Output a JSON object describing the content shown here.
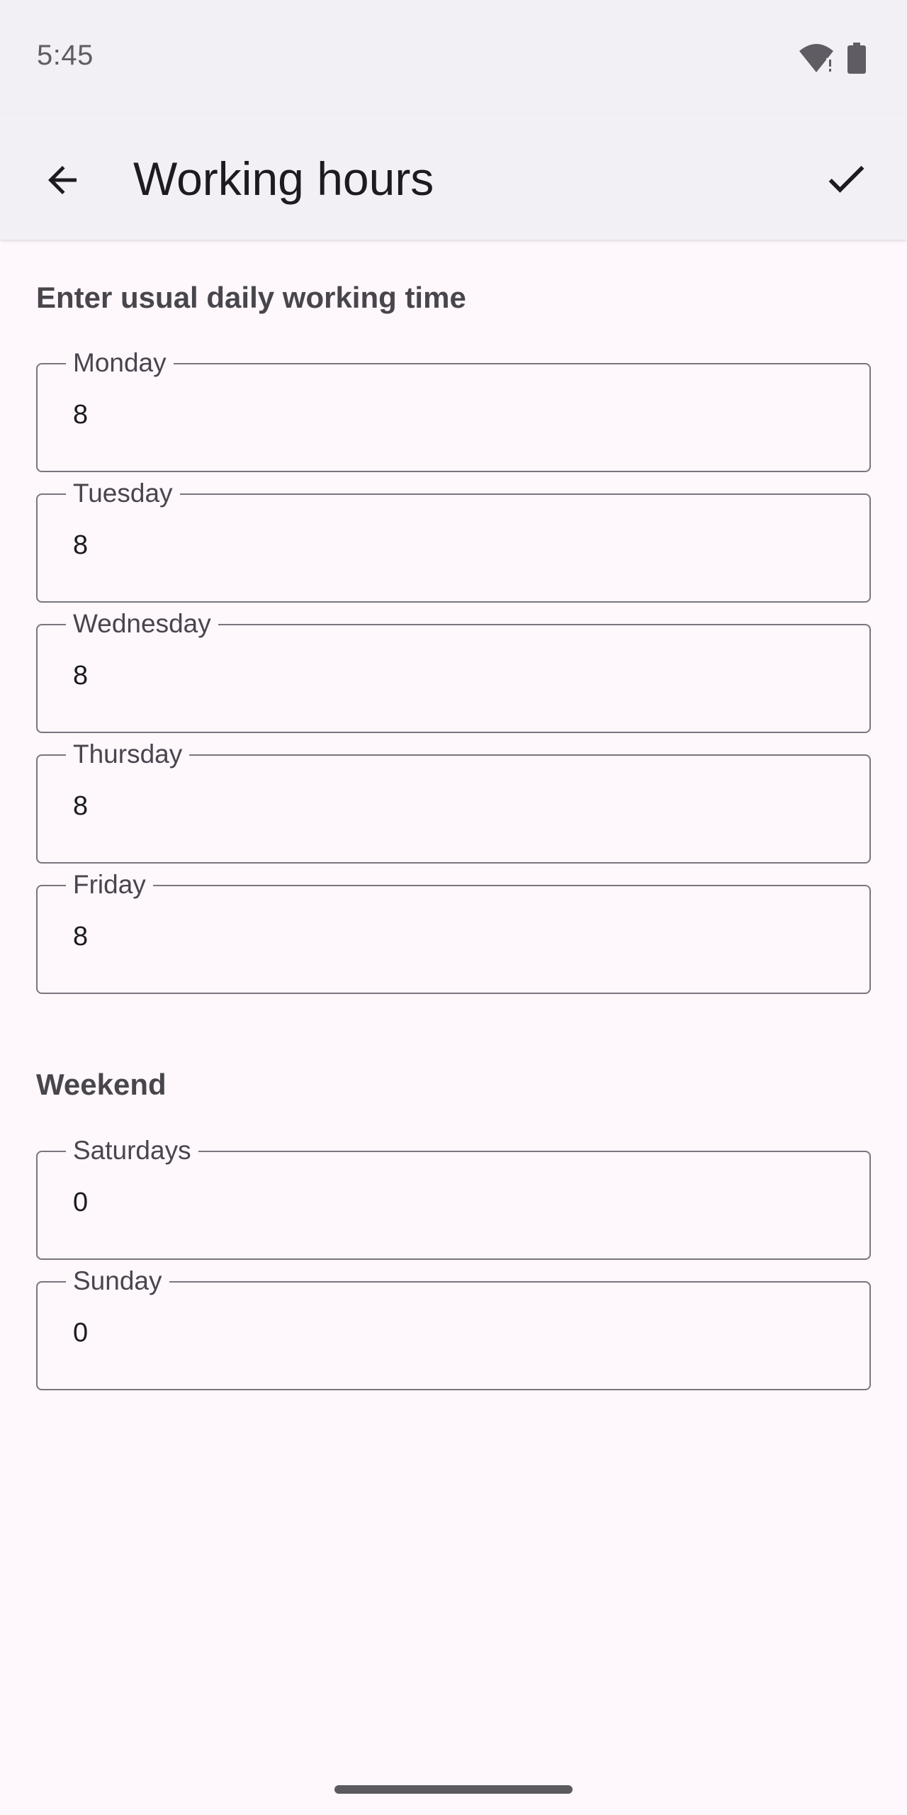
{
  "status_bar": {
    "time": "5:45",
    "icons": [
      "wifi-icon",
      "battery-icon"
    ]
  },
  "app_bar": {
    "title": "Working hours",
    "back_icon": "arrow-left-icon",
    "save_icon": "check-icon"
  },
  "weekday_section": {
    "header": "Enter usual daily working time",
    "fields": [
      {
        "label": "Monday",
        "value": "8"
      },
      {
        "label": "Tuesday",
        "value": "8"
      },
      {
        "label": "Wednesday",
        "value": "8"
      },
      {
        "label": "Thursday",
        "value": "8"
      },
      {
        "label": "Friday",
        "value": "8"
      }
    ]
  },
  "weekend_section": {
    "header": "Weekend",
    "fields": [
      {
        "label": "Saturdays",
        "value": "0"
      },
      {
        "label": "Sunday",
        "value": "0"
      }
    ]
  },
  "colors": {
    "background": "#fef7fb",
    "app_bar": "#f2f0f5",
    "outline": "#7a757f",
    "text_primary": "#1d1b20",
    "text_secondary": "#49454f"
  }
}
